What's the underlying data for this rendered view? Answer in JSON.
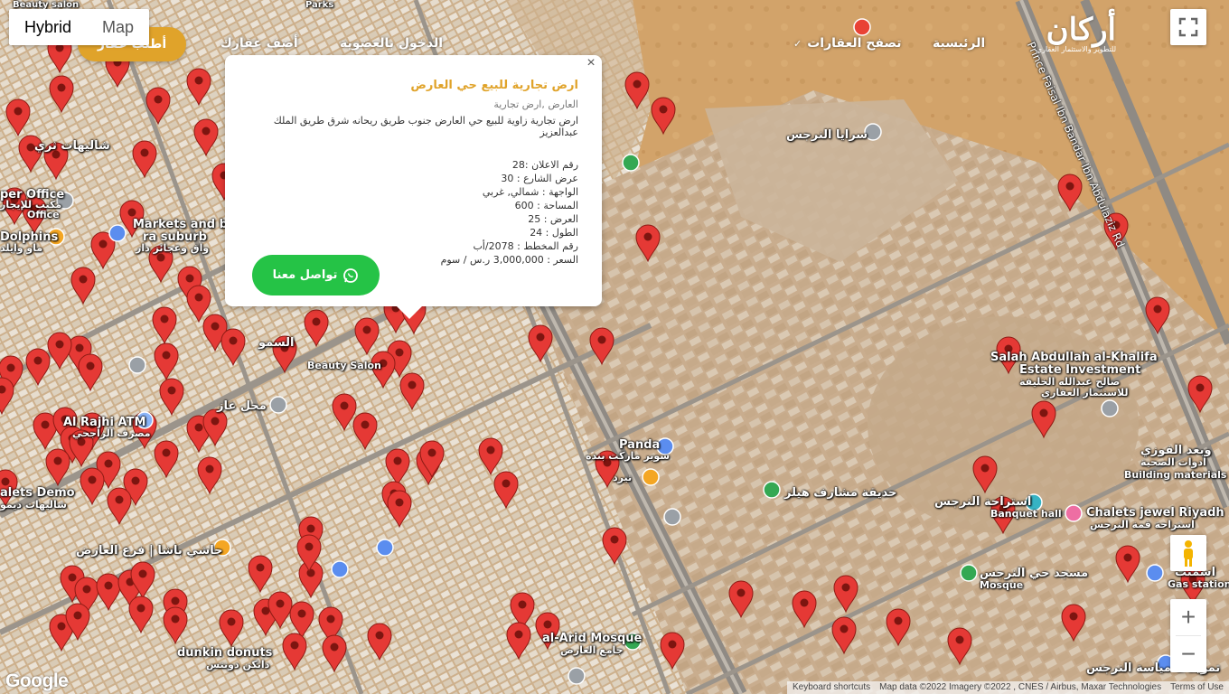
{
  "map": {
    "type_options": [
      "Hybrid",
      "Map"
    ],
    "active_type": "Hybrid",
    "google_logo": "Google",
    "attribution": {
      "keyboard_shortcuts": "Keyboard shortcuts",
      "map_data": "Map data ©2022 Imagery ©2022 , CNES / Airbus, Maxar Technologies",
      "terms": "Terms of Use"
    },
    "marker_color": "#e53935",
    "labels": [
      "شاليهات ثري",
      "per Office",
      "مكتب للإيجار",
      "Office",
      "Dolphins",
      "ماو وايلد",
      "Markets and bak",
      "ra suburb",
      "واق وعجائز دار",
      "Al Rajhi ATM",
      "مصرف الراجحي",
      "alets Demo",
      "شاليهات ديمو",
      "حاشي باشا | فرع العارض",
      "dunkin donuts",
      "دانكن دونتس",
      "محل غاز",
      "السمو",
      "Beauty Salon",
      "Panda",
      "سوبر ماركت بنده",
      "تيرد",
      "حديقة مشارف هيلز",
      "سرايا النرجس",
      "Salah Abdullah al-Khalifa",
      "Estate Investment",
      "صالح عبدالله الخليفة",
      "للاستثمار العقاري",
      "Banquet hall",
      "استراحة النرجس",
      "Chalets jewel Riyadh",
      "استراحة قمة النرجس",
      "مسجد حي النرجس",
      "Mosque",
      "al-Arid Mosque",
      "جامع العارض",
      "وبعد الفوزي",
      "ادوات الصحية",
      "Building materials st",
      "اسمنت",
      "Gas station",
      "تموينات مياسة النرجس",
      "Prince Faisal Ibn Bandar Ibn Abdulaziz Rd",
      "Parks",
      "Beauty salon"
    ]
  },
  "nav": {
    "request_button": "أطلب عقار",
    "add_property": "أضف عقارك",
    "login": "الدخول بالعضوية",
    "browse": "تصفح العقارات",
    "home": "الرئيسية",
    "logo_title": "أركان",
    "logo_subtitle": "للتطوير والاستثمار العقاري"
  },
  "popup": {
    "title": "ارض تجارية للبيع حي العارض",
    "tags": "العارض ,ارض تجارية",
    "description": "ارض تجارية زاوية للبيع حي العارض جنوب طريق ريحانه شرق طريق الملك عبدالعزيز",
    "details": [
      "رقم الاعلان :28",
      "عرض الشارع : 30",
      "الواجهة : شمالي, غربي",
      "المساحة : 600",
      "العرض : 25",
      "الطول : 24",
      "رقم المخطط : 2078/أب",
      "السعر : 3,000,000 ر.س / سوم"
    ],
    "contact_button": "تواصل معنا",
    "close": "×"
  },
  "colors": {
    "accent_gold": "#e0a32a",
    "whatsapp_green": "#25c346",
    "marker_red": "#e53935"
  }
}
